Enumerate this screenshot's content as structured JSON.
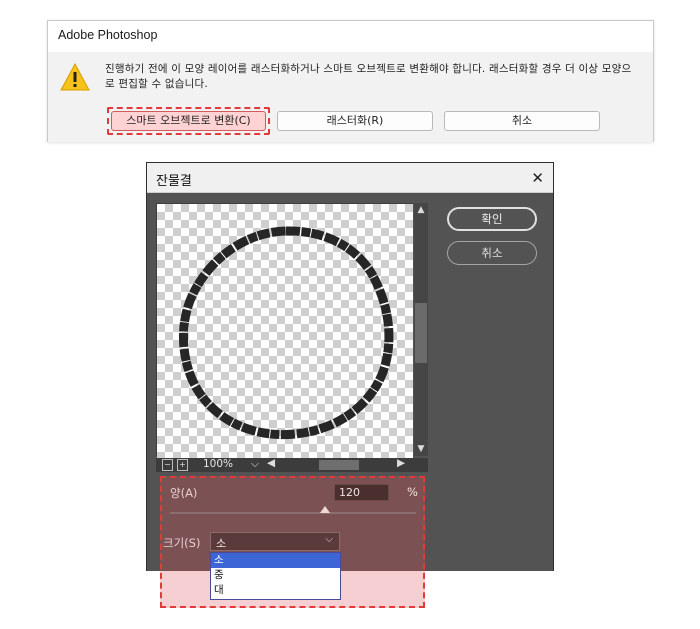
{
  "alert": {
    "title": "Adobe Photoshop",
    "message": "진행하기 전에 이 모양 레이어를 래스터화하거나 스마트 오브젝트로 변환해야 합니다. 래스터화할 경우 더 이상 모양으로 편집할 수 없습니다.",
    "buttons": {
      "convert": "스마트 오브젝트로 변환(C)",
      "rasterize": "래스터화(R)",
      "cancel": "취소"
    },
    "icon": "warning-icon"
  },
  "filter_dialog": {
    "title": "잔물결",
    "ok_label": "확인",
    "cancel_label": "취소",
    "zoom": "100%",
    "amount_label": "양(A)",
    "amount_value": "120",
    "amount_unit": "%",
    "amount_slider_fraction": 0.63,
    "size_label": "크기(S)",
    "size_selected": "소",
    "size_options": [
      "소",
      "중",
      "대"
    ]
  },
  "colors": {
    "highlight": "#e03a3a",
    "dropdown_selected": "#3e65d6",
    "dialog_bg": "#535353"
  }
}
